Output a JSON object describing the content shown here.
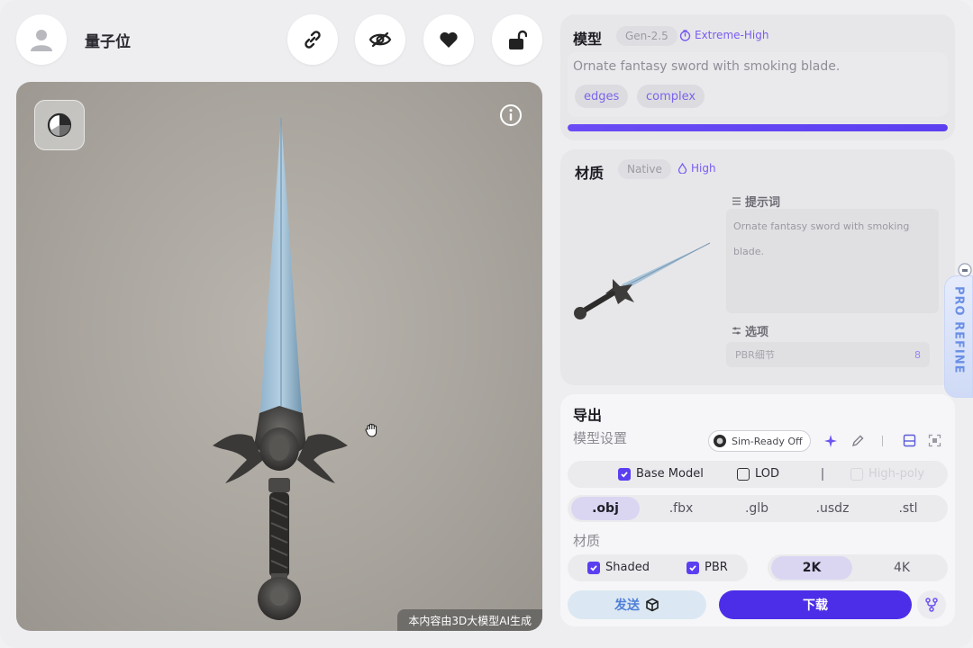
{
  "header": {
    "username": "量子位",
    "buttons": [
      "link-icon",
      "eye-off-icon",
      "heart-icon",
      "unlock-icon"
    ]
  },
  "viewport": {
    "caption": "本内容由3D大模型AI生成"
  },
  "model_panel": {
    "title": "模型",
    "version_chip": "Gen-2.5",
    "quality": "Extreme-High",
    "prompt": "Ornate fantasy sword with smoking blade.",
    "tags": [
      "edges",
      "complex"
    ],
    "progress": 1.0
  },
  "material_panel": {
    "title": "材质",
    "native_chip": "Native",
    "quality": "High",
    "prompt_label": "提示词",
    "prompt_line1": "Ornate fantasy sword with smoking",
    "prompt_line2": "blade.",
    "options_label": "选项",
    "option_name": "PBR细节",
    "option_value": "8"
  },
  "export_panel": {
    "title": "导出",
    "model_settings_label": "模型设置",
    "sim_ready": "Sim-Ready Off",
    "base_model": "Base Model",
    "lod": "LOD",
    "high_poly": "High-poly",
    "formats": [
      ".obj",
      ".fbx",
      ".glb",
      ".usdz",
      ".stl"
    ],
    "active_format": ".obj",
    "material_label": "材质",
    "shaded": "Shaded",
    "pbr": "PBR",
    "res_2k": "2K",
    "res_4k": "4K",
    "send_label": "发送",
    "download_label": "下载"
  },
  "pro_refine": {
    "label": "PRO REFINE"
  },
  "colors": {
    "accent": "#4d2ee8",
    "accent_light": "#7a5cf0",
    "send_blue": "#4f7fd8"
  }
}
